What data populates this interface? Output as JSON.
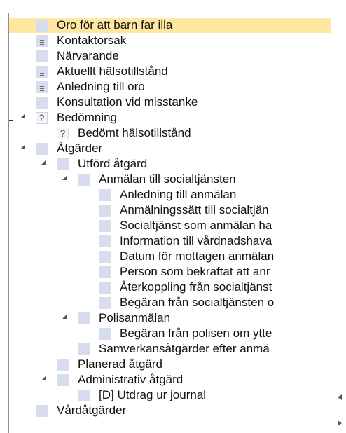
{
  "tree": {
    "items": [
      {
        "label": "Oro för att barn far illa",
        "icon": "doc",
        "selected": true
      },
      {
        "label": "Kontaktorsak",
        "icon": "doc"
      },
      {
        "label": "Närvarande",
        "icon": "blank"
      },
      {
        "label": "Aktuellt hälsotillstånd",
        "icon": "doc"
      },
      {
        "label": "Anledning till oro",
        "icon": "doc"
      },
      {
        "label": "Konsultation vid misstanke",
        "icon": "blank"
      },
      {
        "label": "Bedömning",
        "icon": "question",
        "expanded": true
      },
      {
        "label": "Bedömt hälsotillstånd",
        "icon": "question"
      },
      {
        "label": "Åtgärder",
        "icon": "blank",
        "expanded": true
      },
      {
        "label": "Utförd åtgärd",
        "icon": "blank",
        "expanded": true
      },
      {
        "label": "Anmälan till socialtjänsten",
        "icon": "blank",
        "expanded": true
      },
      {
        "label": "Anledning till anmälan",
        "icon": "blank"
      },
      {
        "label": "Anmälningssätt till socialtjän",
        "icon": "blank"
      },
      {
        "label": "Socialtjänst som anmälan ha",
        "icon": "blank"
      },
      {
        "label": "Information till vårdnadshava",
        "icon": "blank"
      },
      {
        "label": "Datum för mottagen anmälan",
        "icon": "blank"
      },
      {
        "label": "Person som bekräftat att anr",
        "icon": "blank"
      },
      {
        "label": "Återkoppling från socialtjänst",
        "icon": "blank"
      },
      {
        "label": "Begäran från socialtjänsten o",
        "icon": "blank"
      },
      {
        "label": "Polisanmälan",
        "icon": "blank",
        "expanded": true
      },
      {
        "label": "Begäran från polisen om ytte",
        "icon": "blank"
      },
      {
        "label": "Samverkansåtgärder efter anmä",
        "icon": "blank"
      },
      {
        "label": "Planerad åtgärd",
        "icon": "blank"
      },
      {
        "label": "Administrativ åtgärd",
        "icon": "blank",
        "expanded": true
      },
      {
        "label": "[D] Utdrag ur journal",
        "icon": "blank"
      },
      {
        "label": "Vårdåtgärder",
        "icon": "blank"
      }
    ]
  }
}
